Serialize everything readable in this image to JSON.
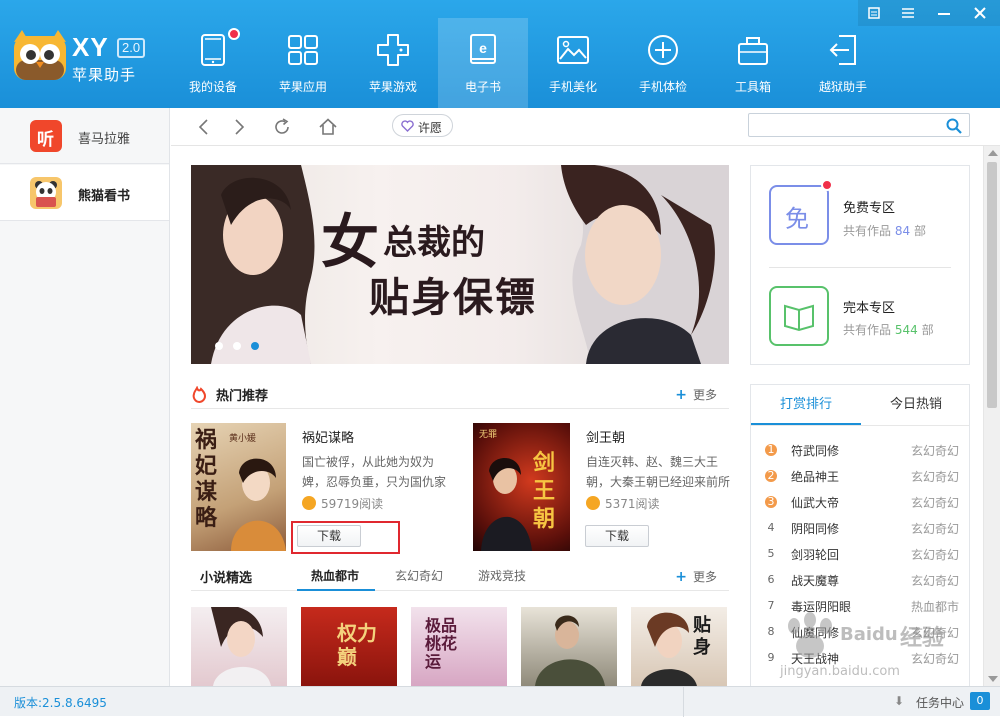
{
  "app": {
    "logo_title": "XY",
    "logo_version": "2.0",
    "logo_subtitle": "苹果助手",
    "brand_color": "#1a8fd8"
  },
  "nav": [
    {
      "label": "我的设备",
      "icon": "tablet-icon",
      "badge": true
    },
    {
      "label": "苹果应用",
      "icon": "apps-grid-icon"
    },
    {
      "label": "苹果游戏",
      "icon": "gamepad-icon"
    },
    {
      "label": "电子书",
      "icon": "ebook-icon",
      "active": true
    },
    {
      "label": "手机美化",
      "icon": "image-icon"
    },
    {
      "label": "手机体检",
      "icon": "plus-circle-icon"
    },
    {
      "label": "工具箱",
      "icon": "toolbox-icon"
    },
    {
      "label": "越狱助手",
      "icon": "exit-icon"
    }
  ],
  "sidebar": {
    "items": [
      {
        "label": "喜马拉雅",
        "icon_text": "听",
        "icon_color": "#f0472b"
      },
      {
        "label": "熊猫看书",
        "active": true
      }
    ]
  },
  "toolbar": {
    "wish_label": "许愿",
    "search_placeholder": ""
  },
  "banner": {
    "headline_1": "女",
    "headline_2": "总裁的",
    "headline_3": "贴身保镖"
  },
  "zones": [
    {
      "title": "免费专区",
      "count_prefix": "共有作品",
      "count": "84",
      "count_suffix": "部",
      "icon_text": "免",
      "color": "#7b8ee8"
    },
    {
      "title": "完本专区",
      "count_prefix": "共有作品",
      "count": "544",
      "count_suffix": "部",
      "color": "#58c26b"
    }
  ],
  "hot": {
    "title": "热门推荐",
    "more": "更多",
    "books": [
      {
        "title": "祸妃谋略",
        "desc": "国亡被俘，从此她为奴为婢，忍辱负重，只为国仇家",
        "reads": "59719阅读",
        "download": "下载",
        "cover_text": "祸妃谋略",
        "cover_author": "黄小媛"
      },
      {
        "title": "剑王朝",
        "desc": "自连灭韩、赵、魏三大王朝，大秦王朝已经迎来前所",
        "reads": "5371阅读",
        "download": "下载",
        "cover_text": "剑王朝",
        "cover_author": "无罪"
      }
    ]
  },
  "novels": {
    "title": "小说精选",
    "more": "更多",
    "tabs": [
      "热血都市",
      "玄幻奇幻",
      "游戏竞技"
    ],
    "covers": [
      {
        "text": ""
      },
      {
        "text": "权力巅"
      },
      {
        "text": "极品桃花运"
      },
      {
        "text": ""
      },
      {
        "text": "贴身"
      }
    ]
  },
  "ranking": {
    "tabs": [
      "打赏排行",
      "今日热销"
    ],
    "rows": [
      {
        "num": "1",
        "title": "符武同修",
        "genre": "玄幻奇幻"
      },
      {
        "num": "2",
        "title": "绝品神王",
        "genre": "玄幻奇幻"
      },
      {
        "num": "3",
        "title": "仙武大帝",
        "genre": "玄幻奇幻"
      },
      {
        "num": "4",
        "title": "阴阳同修",
        "genre": "玄幻奇幻"
      },
      {
        "num": "5",
        "title": "剑羽轮回",
        "genre": "玄幻奇幻"
      },
      {
        "num": "6",
        "title": "战天魔尊",
        "genre": "玄幻奇幻"
      },
      {
        "num": "7",
        "title": "毒运阴阳眼",
        "genre": "热血都市"
      },
      {
        "num": "8",
        "title": "仙魔同修",
        "genre": "玄幻奇幻"
      },
      {
        "num": "9",
        "title": "天王战神",
        "genre": "玄幻奇幻"
      }
    ]
  },
  "status": {
    "version": "版本:2.5.8.6495",
    "task_center": "任务中心",
    "task_count": "0"
  },
  "watermark": {
    "text_1": "Baidu",
    "text_2": "经验",
    "text_3": "jingyan.baidu.com"
  }
}
